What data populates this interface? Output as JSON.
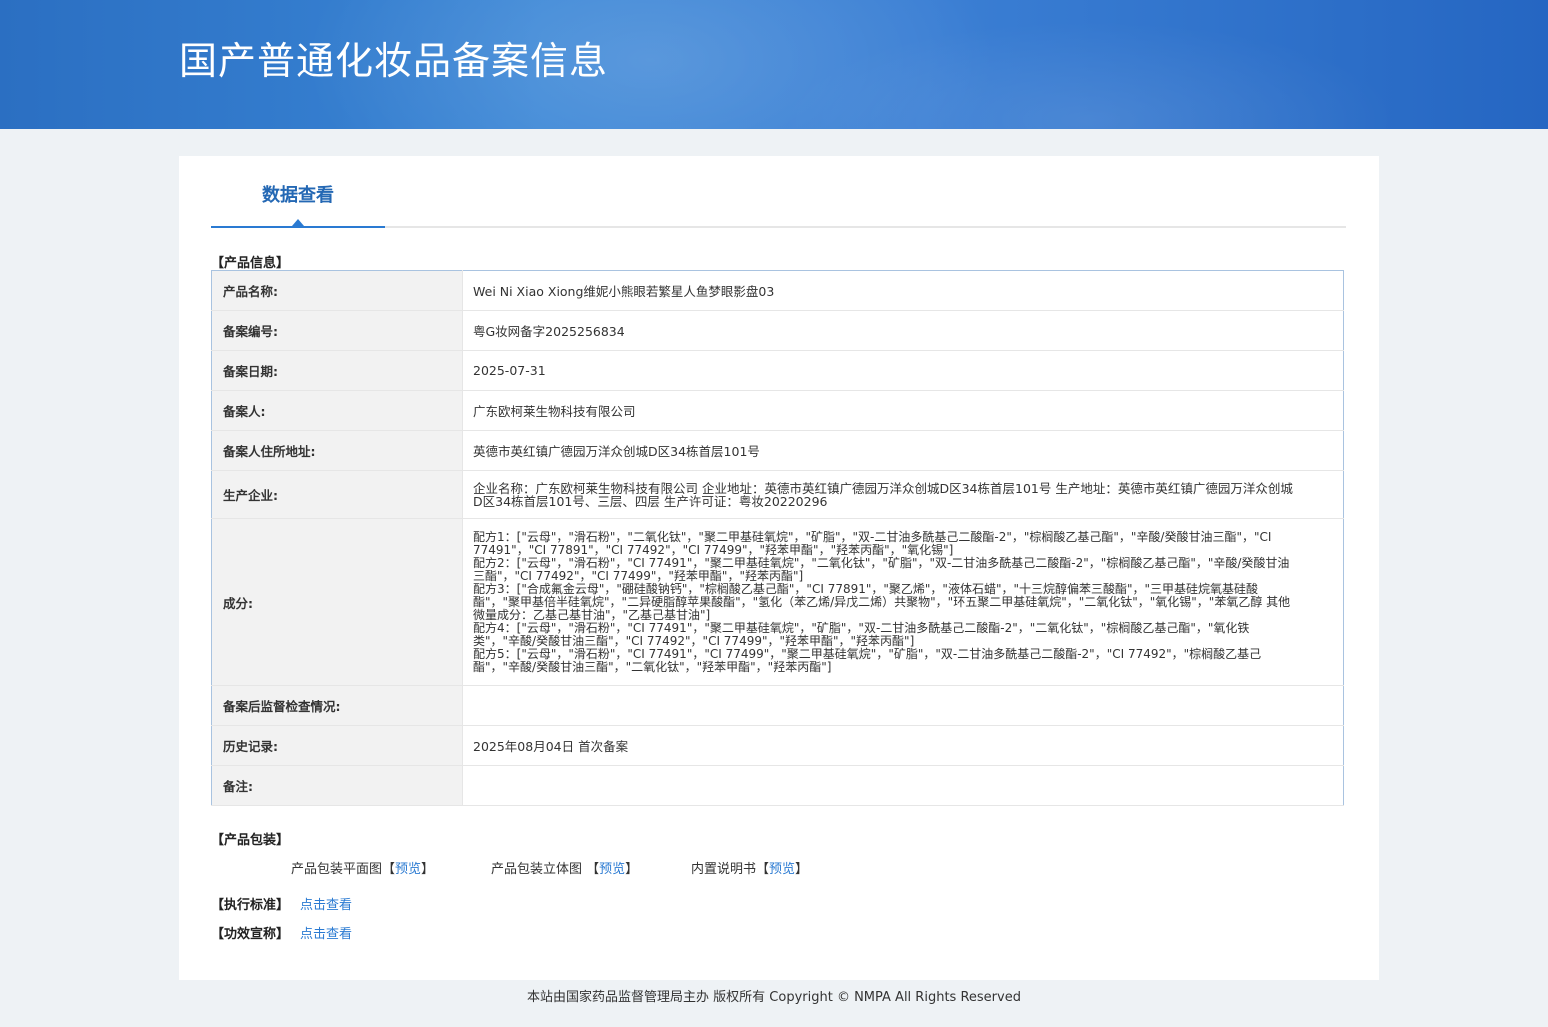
{
  "header": {
    "title": "国产普通化妆品备案信息"
  },
  "tabs": [
    {
      "label": "数据查看"
    }
  ],
  "product_info": {
    "section_label": "【产品信息】",
    "rows": [
      {
        "key": "产品名称:",
        "value": "Wei Ni Xiao Xiong维妮小熊眼若繁星人鱼梦眼影盘03"
      },
      {
        "key": "备案编号:",
        "value": "粤G妆网备字2025256834"
      },
      {
        "key": "备案日期:",
        "value": "2025-07-31"
      },
      {
        "key": "备案人:",
        "value": "广东欧柯莱生物科技有限公司"
      },
      {
        "key": "备案人住所地址:",
        "value": "英德市英红镇广德园万洋众创城D区34栋首层101号"
      },
      {
        "key": "生产企业:",
        "value": "企业名称：广东欧柯莱生物科技有限公司 企业地址：英德市英红镇广德园万洋众创城D区34栋首层101号 生产地址：英德市英红镇广德园万洋众创城D区34栋首层101号、三层、四层 生产许可证：粤妆20220296"
      },
      {
        "key": "成分:",
        "value": [
          "配方1：[\"云母\"，\"滑石粉\"，\"二氧化钛\"，\"聚二甲基硅氧烷\"，\"矿脂\"，\"双-二甘油多酰基己二酸酯-2\"，\"棕榈酸乙基己酯\"，\"辛酸/癸酸甘油三酯\"，\"CI 77491\"，\"CI 77891\"，\"CI 77492\"，\"CI 77499\"，\"羟苯甲酯\"，\"羟苯丙酯\"，\"氧化锡\"]",
          "配方2：[\"云母\"，\"滑石粉\"，\"CI 77491\"，\"聚二甲基硅氧烷\"，\"二氧化钛\"，\"矿脂\"，\"双-二甘油多酰基己二酸酯-2\"，\"棕榈酸乙基己酯\"，\"辛酸/癸酸甘油三酯\"，\"CI 77492\"，\"CI 77499\"，\"羟苯甲酯\"，\"羟苯丙酯\"]",
          "配方3：[\"合成氟金云母\"，\"硼硅酸钠钙\"，\"棕榈酸乙基己酯\"，\"CI 77891\"，\"聚乙烯\"，\"液体石蜡\"，\"十三烷醇偏苯三酸酯\"，\"三甲基硅烷氧基硅酸酯\"，\"聚甲基倍半硅氧烷\"，\"二异硬脂醇苹果酸酯\"，\"氢化（苯乙烯/异戊二烯）共聚物\"，\"环五聚二甲基硅氧烷\"，\"二氧化钛\"，\"氧化锡\"，\"苯氧乙醇 其他微量成分：乙基己基甘油\"，\"乙基己基甘油\"]",
          "配方4：[\"云母\"，\"滑石粉\"，\"CI 77491\"，\"聚二甲基硅氧烷\"，\"矿脂\"，\"双-二甘油多酰基己二酸酯-2\"，\"二氧化钛\"，\"棕榈酸乙基己酯\"，\"氧化铁类\"，\"辛酸/癸酸甘油三酯\"，\"CI 77492\"，\"CI 77499\"，\"羟苯甲酯\"，\"羟苯丙酯\"]",
          "配方5：[\"云母\"，\"滑石粉\"，\"CI 77491\"，\"CI 77499\"，\"聚二甲基硅氧烷\"，\"矿脂\"，\"双-二甘油多酰基己二酸酯-2\"，\"CI 77492\"，\"棕榈酸乙基己酯\"，\"辛酸/癸酸甘油三酯\"，\"二氧化钛\"，\"羟苯甲酯\"，\"羟苯丙酯\"]"
        ]
      },
      {
        "key": "备案后监督检查情况:",
        "value": ""
      },
      {
        "key": "历史记录:",
        "value": "2025年08月04日 首次备案"
      },
      {
        "key": "备注:",
        "value": ""
      }
    ]
  },
  "packaging": {
    "section_label": "【产品包装】",
    "items": [
      {
        "label": "产品包装平面图",
        "bracket_open": "【",
        "link": "预览",
        "bracket_close": "】"
      },
      {
        "label": "产品包装立体图 ",
        "bracket_open": "【",
        "link": "预览",
        "bracket_close": "】"
      },
      {
        "label": "内置说明书",
        "bracket_open": "【",
        "link": "预览",
        "bracket_close": "】"
      }
    ]
  },
  "standard": {
    "section_label": "【执行标准】",
    "link": "点击查看"
  },
  "efficacy": {
    "section_label": "【功效宣称】",
    "link": "点击查看"
  },
  "footer": {
    "text": "本站由国家药品监督管理局主办 版权所有 Copyright © NMPA All Rights Reserved"
  }
}
